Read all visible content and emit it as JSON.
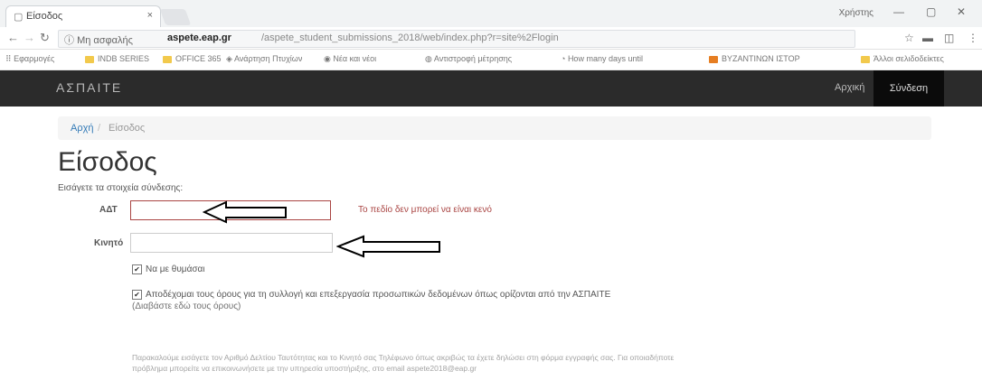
{
  "browser": {
    "tab_title": "Είσοδος",
    "tab_close": "×",
    "user_label": "Χρήστης",
    "security_label": "Μη ασφαλής",
    "url_host": "aspete.eap.gr",
    "url_path": "/aspete_student_submissions_2018/web/index.php?r=site%2Flogin",
    "bookmarks": [
      "Εφαρμογές",
      "INDB SERIES",
      "OFFICE 365",
      "Ανάρτηση Πτυχίων",
      "Νέα και νέοι",
      "Αντιστροφή μέτρησης",
      "How many days until",
      "ΒΥΖΑΝΤΙΝΩΝ ΙΣΤΟΡ",
      "Άλλοι σελιδοδείκτες"
    ]
  },
  "navbar": {
    "brand": "ΑΣΠΑΙΤΕ",
    "home_label": "Αρχική",
    "login_label": "Σύνδεση"
  },
  "breadcrumb": {
    "home": "Αρχή",
    "separator": "/",
    "current": "Είσοδος"
  },
  "page": {
    "title": "Είσοδος",
    "instructions": "Εισάγετε τα στοιχεία σύνδεσης:"
  },
  "form": {
    "adt_label": "ΑΔΤ",
    "adt_value": "",
    "adt_error": "Το πεδίο δεν μπορεί να είναι κενό",
    "mobile_label": "Κινητό",
    "mobile_value": "",
    "remember_label": "Να με θυμάσαι",
    "terms_label": "Αποδέχομαι τους όρους για τη συλλογή και επεξεργασία προσωπικών δεδομένων όπως ορίζονται από την ΑΣΠΑΙΤΕ",
    "terms_link": "(Διαβάστε εδώ τους όρους)"
  },
  "notice": {
    "line1": "Παρακαλούμε εισάγετε τον Αριθμό Δελτίου Ταυτότητας και το Κινητό σας Τηλέφωνο όπως ακριβώς τα έχετε δηλώσει στη φόρμα εγγραφής σας. Για οποιαδήποτε",
    "line2": "πρόβλημα μπορείτε να επικοινωνήσετε με την υπηρεσία υποστήριξης, στο email aspete2018@eap.gr"
  },
  "colors": {
    "navbar_bg": "#2b2b2b",
    "error": "#a94442",
    "link": "#337ab7"
  }
}
